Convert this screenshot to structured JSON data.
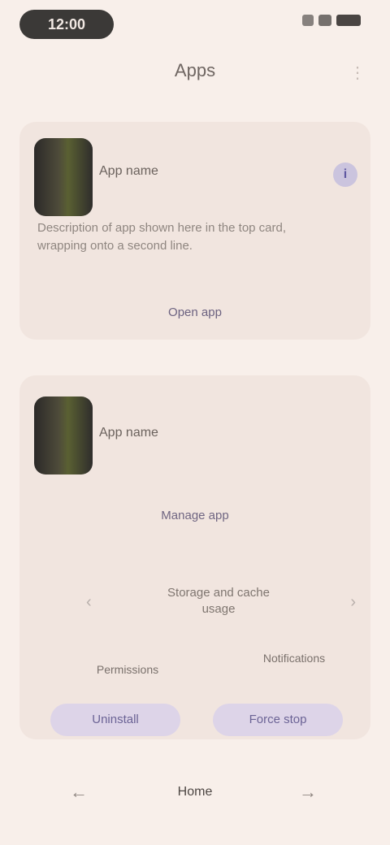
{
  "status_bar": {
    "time": "12:00",
    "icons": [
      "signal-icon",
      "wifi-icon",
      "battery-icon"
    ]
  },
  "header": {
    "title": "Apps",
    "menu_icon": "more-vert-icon"
  },
  "cards": [
    {
      "app_name": "App name",
      "info_icon": "info-icon",
      "description": "Description of app shown here in the top card, wrapping onto a second line.",
      "link_label": "Open app"
    },
    {
      "app_name": "App name",
      "sub_link": "Manage app",
      "center_text": "Storage and cache usage",
      "label_left": "Permissions",
      "label_right": "Notifications",
      "button_left": "Uninstall",
      "button_right": "Force stop"
    }
  ],
  "bottom_nav": {
    "back_icon": "back-icon",
    "home_label": "Home",
    "forward_icon": "forward-icon"
  }
}
